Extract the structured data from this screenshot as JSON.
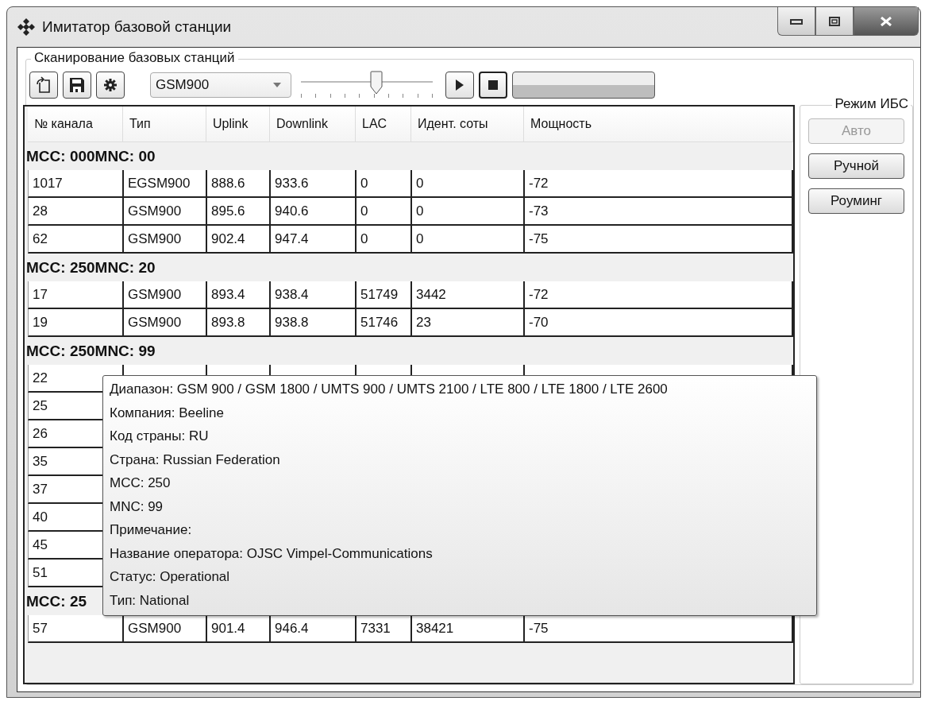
{
  "window": {
    "title": "Имитатор базовой станции"
  },
  "scan_group": {
    "title": "Сканирование базовых станций"
  },
  "toolbar": {
    "band": "GSM900",
    "slider": {
      "level": 0.57
    },
    "progress": {
      "level": 0
    }
  },
  "table": {
    "columns": [
      "№ канала",
      "Тип",
      "Uplink",
      "Downlink",
      "LAC",
      "Идент. соты",
      "Мощность"
    ],
    "groups": [
      {
        "header": "MCC: 000MNC: 00",
        "rows": [
          [
            "1017",
            "EGSM900",
            "888.6",
            "933.6",
            "0",
            "0",
            "-72"
          ],
          [
            "28",
            "GSM900",
            "895.6",
            "940.6",
            "0",
            "0",
            "-73"
          ],
          [
            "62",
            "GSM900",
            "902.4",
            "947.4",
            "0",
            "0",
            "-75"
          ]
        ]
      },
      {
        "header": "MCC: 250MNC: 20",
        "rows": [
          [
            "17",
            "GSM900",
            "893.4",
            "938.4",
            "51749",
            "3442",
            "-72"
          ],
          [
            "19",
            "GSM900",
            "893.8",
            "938.8",
            "51746",
            "23",
            "-70"
          ]
        ]
      },
      {
        "header": "MCC: 250MNC: 99",
        "rows": [
          [
            "22"
          ],
          [
            "25"
          ],
          [
            "26"
          ],
          [
            "35"
          ],
          [
            "37"
          ],
          [
            "40"
          ],
          [
            "45"
          ],
          [
            "51"
          ]
        ]
      },
      {
        "header": "MCC: 25",
        "rows": [
          [
            "57",
            "GSM900",
            "901.4",
            "946.4",
            "7331",
            "38421",
            "-75"
          ]
        ]
      }
    ]
  },
  "mode_panel": {
    "title": "Режим ИБС",
    "buttons": [
      {
        "label": "Авто",
        "disabled": true
      },
      {
        "label": "Ручной",
        "disabled": false
      },
      {
        "label": "Роуминг",
        "disabled": false
      }
    ]
  },
  "tooltip": {
    "lines": [
      "Диапазон: GSM 900 / GSM 1800 / UMTS 900 / UMTS 2100 / LTE 800 / LTE 1800 / LTE 2600",
      "Компания: Beeline",
      "Код страны: RU",
      "Страна: Russian Federation",
      "MCC: 250",
      "MNC: 99",
      "Примечание:",
      "Название оператора: OJSC Vimpel-Communications",
      "Статус: Operational",
      "Тип: National"
    ]
  }
}
